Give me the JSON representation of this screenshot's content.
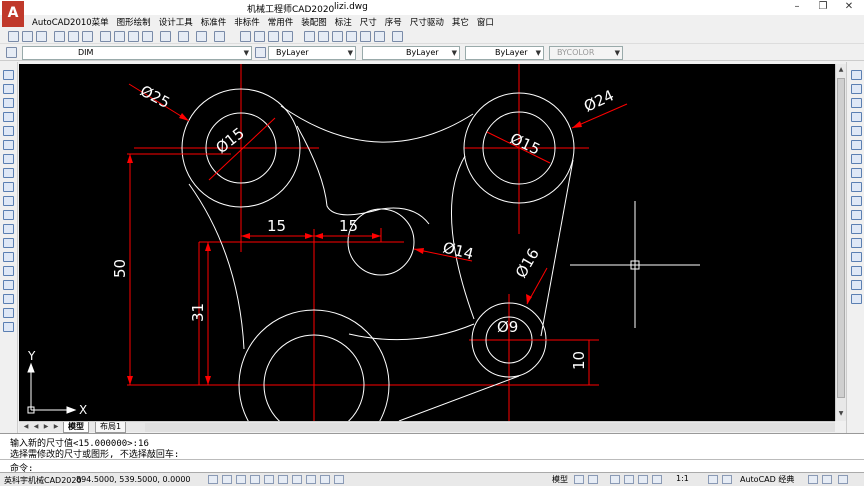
{
  "window": {
    "title": "机械工程师CAD2020",
    "document": "lizi.dwg"
  },
  "menu": {
    "items": [
      "AutoCAD2010菜单",
      "图形绘制",
      "设计工具",
      "标准件",
      "非标件",
      "常用件",
      "装配图",
      "标注",
      "尺寸",
      "序号",
      "尺寸驱动",
      "其它",
      "窗口"
    ]
  },
  "toolbar": {
    "layer_name": "DIM",
    "color_combo": "ByLayer",
    "linetype_combo": "ByLayer",
    "lineweight_combo": "ByLayer",
    "plotstyle_combo": "BYCOLOR"
  },
  "drawing": {
    "dimensions": {
      "d25": "Ø25",
      "d24": "Ø24",
      "d15_left": "Ø15",
      "d15_right": "Ø15",
      "d14": "Ø14",
      "d16": "Ø16",
      "d9": "Ø9",
      "h15_left": "15",
      "h15_right": "15",
      "v50": "50",
      "v31": "31",
      "v10": "10"
    },
    "ucs": {
      "x": "X",
      "y": "Y"
    }
  },
  "tabs": [
    {
      "label": "模型"
    },
    {
      "label": "布局1"
    }
  ],
  "command": {
    "line1": "输入新的尺寸值<15.000000>:16",
    "line2": "选择需修改的尺寸或图形, 不选择敲回车:",
    "prompt": "命令:"
  },
  "status": {
    "app_name": "英科宇机械CAD2020",
    "coords": "894.5000, 539.5000, 0.0000",
    "model_label": "模型",
    "scale": "1:1",
    "workspace": "AutoCAD 经典"
  },
  "colors": {
    "canvas": "#000000",
    "geometry": "#ffffff",
    "dimension": "#ff0000",
    "center_line": "#ff0000",
    "accent": "#c0392b"
  }
}
